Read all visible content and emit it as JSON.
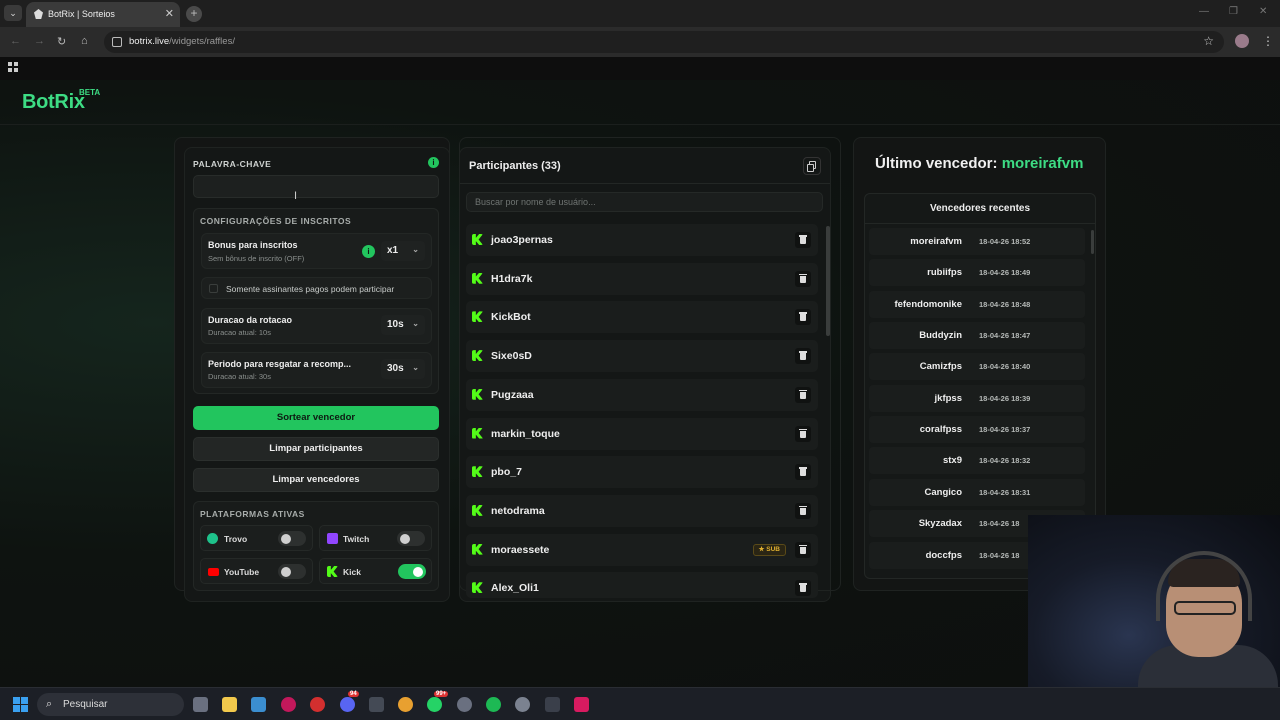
{
  "browser": {
    "tab_title": "BotRix | Sorteios",
    "url_host": "botrix.live",
    "url_path": "/widgets/raffles/"
  },
  "header": {
    "logo": "BotRix",
    "logo_badge": "BETA"
  },
  "settings_panel": {
    "keyword_label": "PALAVRA-CHAVE",
    "keyword_value": "",
    "subscriber_section_title": "CONFIGURAÇÕES DE INSCRITOS",
    "sub_bonus_title": "Bonus para inscritos",
    "sub_bonus_sub": "Sem bônus de inscrito (OFF)",
    "sub_bonus_value": "x1",
    "paid_only_label": "Somente assinantes pagos podem participar",
    "paid_only_checked": false,
    "rotation_title": "Duracao da rotacao",
    "rotation_sub": "Duracao atual: 10s",
    "rotation_value": "10s",
    "claim_title": "Periodo para resgatar a recomp...",
    "claim_sub": "Duracao atual: 30s",
    "claim_value": "30s",
    "draw_button": "Sortear vencedor",
    "clear_participants_button": "Limpar participantes",
    "clear_winners_button": "Limpar vencedores",
    "platforms_title": "PLATAFORMAS ATIVAS",
    "platforms": [
      {
        "name": "Trovo",
        "enabled": false,
        "color": "#1ec28b"
      },
      {
        "name": "Twitch",
        "enabled": false,
        "color": "#9146ff"
      },
      {
        "name": "YouTube",
        "enabled": false,
        "color": "#ff0000"
      },
      {
        "name": "Kick",
        "enabled": true,
        "color": "#53fc18"
      }
    ]
  },
  "participants_panel": {
    "title": "Participantes (33)",
    "search_placeholder": "Buscar por nome de usuário...",
    "participants": [
      {
        "name": "joao3pernas",
        "badge": ""
      },
      {
        "name": "H1dra7k",
        "badge": ""
      },
      {
        "name": "KickBot",
        "badge": ""
      },
      {
        "name": "Sixe0sD",
        "badge": ""
      },
      {
        "name": "Pugzaaa",
        "badge": ""
      },
      {
        "name": "markin_toque",
        "badge": ""
      },
      {
        "name": "pbo_7",
        "badge": ""
      },
      {
        "name": "netodrama",
        "badge": ""
      },
      {
        "name": "moraessete",
        "badge": "★ SUB"
      },
      {
        "name": "Alex_Oli1",
        "badge": ""
      }
    ]
  },
  "winners_panel": {
    "last_winner_label": "Último vencedor:",
    "last_winner_name": "moreirafvm",
    "recent_title": "Vencedores recentes",
    "winners": [
      {
        "name": "moreirafvm",
        "date": "18-04-26 18:52"
      },
      {
        "name": "rubiifps",
        "date": "18-04-26 18:49"
      },
      {
        "name": "fefendomonike",
        "date": "18-04-26 18:48"
      },
      {
        "name": "Buddyzin",
        "date": "18-04-26 18:47"
      },
      {
        "name": "Camizfps",
        "date": "18-04-26 18:40"
      },
      {
        "name": "jkfpss",
        "date": "18-04-26 18:39"
      },
      {
        "name": "coralfpss",
        "date": "18-04-26 18:37"
      },
      {
        "name": "stx9",
        "date": "18-04-26 18:32"
      },
      {
        "name": "Cangico",
        "date": "18-04-26 18:31"
      },
      {
        "name": "Skyzadax",
        "date": "18-04-26 18"
      },
      {
        "name": "doccfps",
        "date": "18-04-26 18"
      }
    ]
  },
  "taskbar": {
    "search_label": "Pesquisar",
    "badge_1": "94",
    "badge_2": "99+"
  }
}
